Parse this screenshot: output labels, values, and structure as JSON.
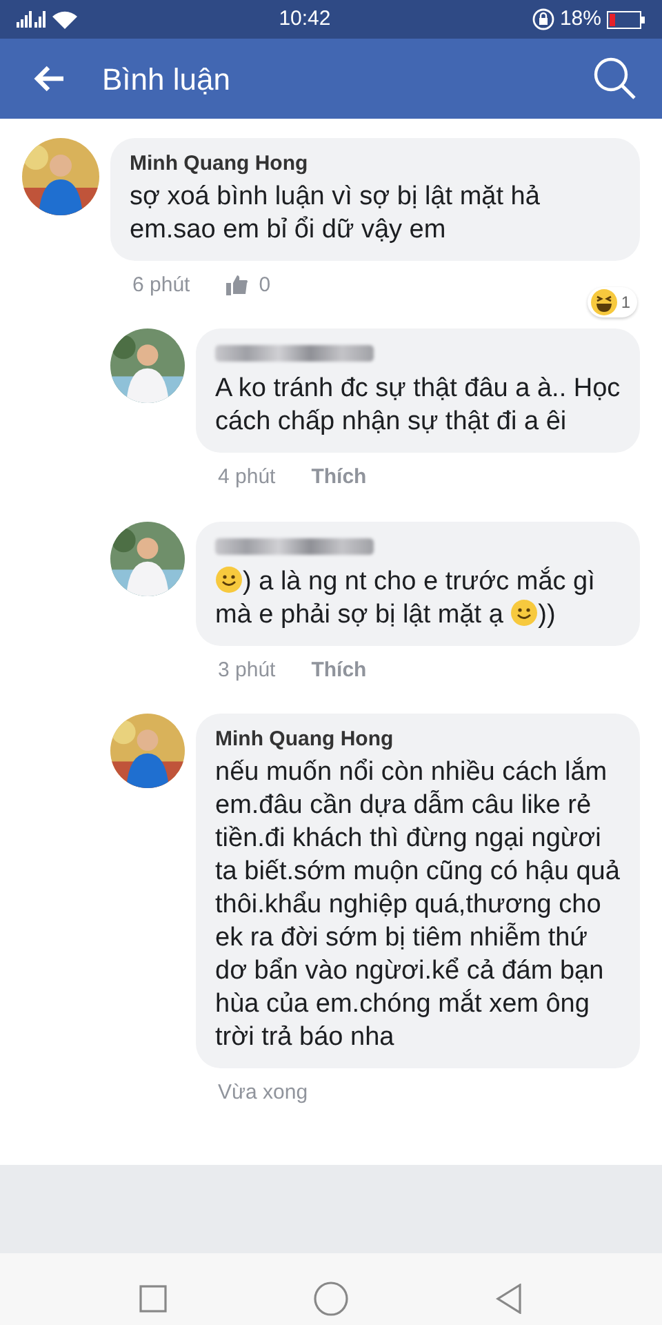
{
  "status_bar": {
    "time": "10:42",
    "battery": "18%"
  },
  "app_bar": {
    "title": "Bình luận"
  },
  "comments": [
    {
      "reply": false,
      "author": "Minh Quang Hong",
      "author_blurred": false,
      "body": [
        {
          "kind": "text",
          "text": "sợ xoá bình luận vì sợ bị lật mặt hả em.sao em bỉ ổi dữ vậy em"
        }
      ],
      "time": "6 phút",
      "likes": "0",
      "reaction_count": "1"
    },
    {
      "reply": true,
      "author_blurred": true,
      "body": [
        {
          "kind": "text",
          "text": "A ko tránh đc sự thật đâu a à.. Học cách chấp nhận sự thật đi a êi"
        }
      ],
      "time": "4 phút",
      "action": "Thích"
    },
    {
      "reply": true,
      "author_blurred": true,
      "body": [
        {
          "kind": "emoji"
        },
        {
          "kind": "text",
          "text": ") a là ng nt cho e trước mắc gì mà e phải sợ bị lật mặt ạ "
        },
        {
          "kind": "emoji"
        },
        {
          "kind": "text",
          "text": "))"
        }
      ],
      "time": "3 phút",
      "action": "Thích"
    },
    {
      "reply": true,
      "author": "Minh Quang Hong",
      "author_blurred": false,
      "body": [
        {
          "kind": "text",
          "text": "nếu muốn nổi còn nhiều cách lắm em.đâu cần dựa dẫm câu like rẻ tiền.đi khách thì đừng ngại ngừơi ta biết.sớm muộn cũng có hậu quả thôi.khẩu nghiệp quá,thương cho ek ra đời sớm bị tiêm nhiễm thứ dơ bẩn vào ngừơi.kể cả đám bạn hùa của em.chóng mắt xem ông trời trả báo nha"
        }
      ],
      "time": "Vừa xong"
    }
  ]
}
